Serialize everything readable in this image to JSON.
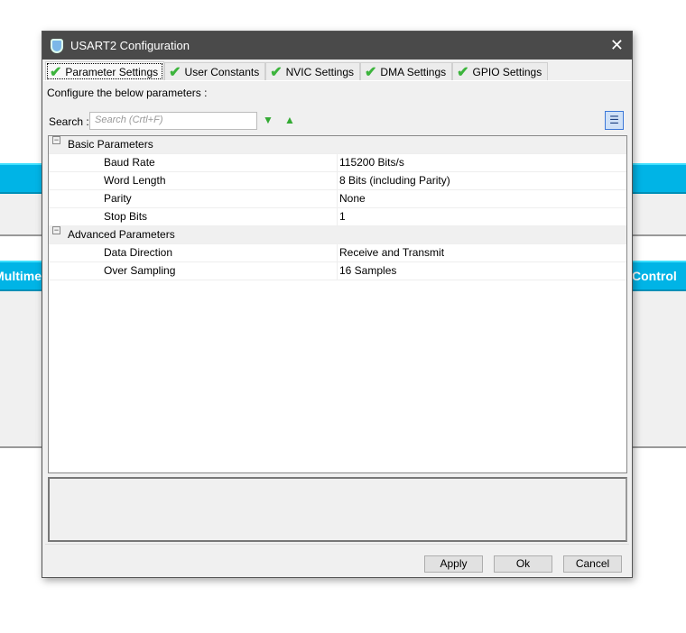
{
  "background": {
    "left_label": "Multime",
    "right_label": "Control"
  },
  "dialog": {
    "title": "USART2 Configuration",
    "close": "✕"
  },
  "tabs": [
    {
      "label": "Parameter Settings"
    },
    {
      "label": "User Constants"
    },
    {
      "label": "NVIC Settings"
    },
    {
      "label": "DMA Settings"
    },
    {
      "label": "GPIO Settings"
    }
  ],
  "instruction": "Configure the below parameters :",
  "search": {
    "label": "Search :",
    "placeholder": "Search (Crtl+F)"
  },
  "groups": [
    {
      "name": "Basic Parameters",
      "params": [
        {
          "name": "Baud Rate",
          "value": "115200 Bits/s"
        },
        {
          "name": "Word Length",
          "value": "8 Bits (including Parity)"
        },
        {
          "name": "Parity",
          "value": "None"
        },
        {
          "name": "Stop Bits",
          "value": "1"
        }
      ]
    },
    {
      "name": "Advanced Parameters",
      "params": [
        {
          "name": "Data Direction",
          "value": "Receive and Transmit"
        },
        {
          "name": "Over Sampling",
          "value": "16 Samples"
        }
      ]
    }
  ],
  "buttons": {
    "apply": "Apply",
    "ok": "Ok",
    "cancel": "Cancel"
  }
}
